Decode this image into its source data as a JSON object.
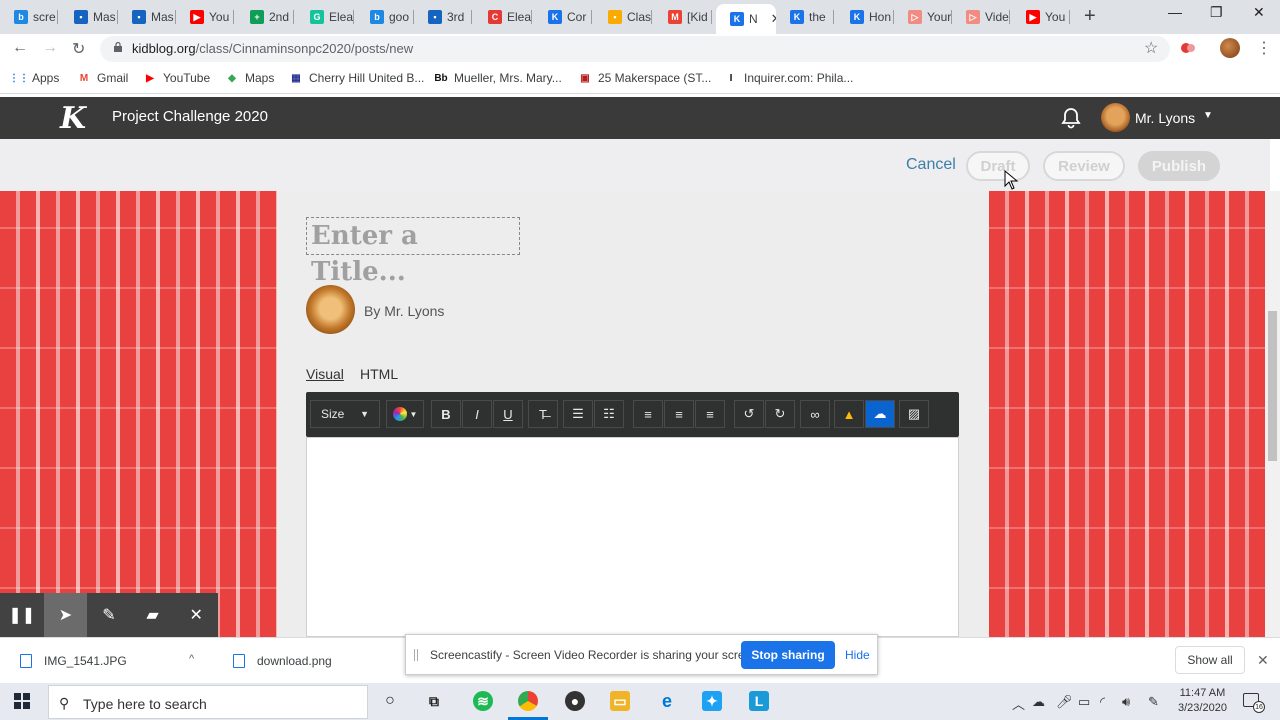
{
  "colors": {
    "tabstrip_bg": "#dee1e6",
    "kb_header_bg": "#3a3a3a",
    "actionbar_bg": "#eeeef0",
    "pattern_red": "#e8413f",
    "pattern_pink": "#f29a9a",
    "link_blue": "#3b7fa6",
    "editor_toolbar_bg": "#2f3030",
    "stop_button_blue": "#1a73e8"
  },
  "browser": {
    "tabs": [
      {
        "title": "scre",
        "icon": "kidblog-b-icon",
        "color": "#1e88e5",
        "glyph": "b"
      },
      {
        "title": "Mas",
        "icon": "person-card-icon",
        "color": "#1565c0",
        "glyph": "▪"
      },
      {
        "title": "Mas",
        "icon": "person-card-icon",
        "color": "#1565c0",
        "glyph": "▪"
      },
      {
        "title": "You",
        "icon": "youtube-icon",
        "color": "#ff0000",
        "glyph": "▶"
      },
      {
        "title": "2nd",
        "icon": "sheets-plus-icon",
        "color": "#0f9d58",
        "glyph": "+"
      },
      {
        "title": "Elea",
        "icon": "grammarly-g-icon",
        "color": "#15c39a",
        "glyph": "G"
      },
      {
        "title": "goo",
        "icon": "kidblog-b-icon",
        "color": "#1e88e5",
        "glyph": "b"
      },
      {
        "title": "3rd",
        "icon": "person-card-icon",
        "color": "#1565c0",
        "glyph": "▪"
      },
      {
        "title": "Elea",
        "icon": "clip-icon",
        "color": "#e53935",
        "glyph": "C"
      },
      {
        "title": "Cor",
        "icon": "kidblog-k-icon",
        "color": "#1a73e8",
        "glyph": "K"
      },
      {
        "title": "Clas",
        "icon": "classroom-icon",
        "color": "#f9ab00",
        "glyph": "▪"
      },
      {
        "title": "[Kid",
        "icon": "gmail-icon",
        "color": "#ea4335",
        "glyph": "M"
      },
      {
        "title": "N",
        "icon": "kidblog-k-icon",
        "color": "#1a73e8",
        "glyph": "K",
        "active": true
      },
      {
        "title": "the",
        "icon": "kidblog-k-icon",
        "color": "#1a73e8",
        "glyph": "K"
      },
      {
        "title": "Hon",
        "icon": "kidblog-k-icon",
        "color": "#1a73e8",
        "glyph": "K"
      },
      {
        "title": "Your",
        "icon": "screencastify-icon",
        "color": "#f28b82",
        "glyph": "▷"
      },
      {
        "title": "Vide",
        "icon": "screencastify-icon",
        "color": "#f28b82",
        "glyph": "▷"
      },
      {
        "title": "You",
        "icon": "youtube-icon",
        "color": "#ff0000",
        "glyph": "▶"
      }
    ],
    "new_tab_glyph": "+",
    "close_glyph": "✕",
    "window_buttons": {
      "minimize": "—",
      "restore": "❐",
      "close": "✕"
    },
    "url_domain": "kidblog.org",
    "url_path": "/class/Cinnaminsonpc2020/posts/new",
    "bookmarks": [
      {
        "label": "Apps",
        "icon": "apps-grid-icon",
        "glyph": "⋮⋮",
        "color": "#1a73e8"
      },
      {
        "label": "Gmail",
        "icon": "gmail-icon",
        "glyph": "M",
        "color": "#ea4335"
      },
      {
        "label": "YouTube",
        "icon": "youtube-icon",
        "glyph": "▶",
        "color": "#ff0000"
      },
      {
        "label": "Maps",
        "icon": "maps-icon",
        "glyph": "◆",
        "color": "#34a853"
      },
      {
        "label": "Cherry Hill United B...",
        "icon": "bookmark-site-icon",
        "glyph": "▦",
        "color": "#283593"
      },
      {
        "label": "Mueller, Mrs. Mary...",
        "icon": "blackboard-icon",
        "glyph": "Bb",
        "color": "#111111"
      },
      {
        "label": "25 Makerspace (ST...",
        "icon": "bookmark-site-icon",
        "glyph": "▣",
        "color": "#b71c1c"
      },
      {
        "label": "Inquirer.com: Phila...",
        "icon": "inquirer-icon",
        "glyph": "I",
        "color": "#111111"
      }
    ]
  },
  "kidblog": {
    "logo": "K",
    "class_title": "Project Challenge 2020",
    "user_name": "Mr. Lyons",
    "caret": "▼",
    "actions": {
      "cancel": "Cancel",
      "draft": "Draft",
      "review": "Review",
      "publish": "Publish"
    },
    "post": {
      "title_placeholder": "Enter a Title...",
      "byline": "By Mr. Lyons",
      "mode_visual": "Visual",
      "mode_html": "HTML"
    },
    "editor_toolbar": {
      "size_label": "Size",
      "buttons": [
        {
          "name": "bold-button",
          "glyph": "B"
        },
        {
          "name": "italic-button",
          "glyph": "I"
        },
        {
          "name": "underline-button",
          "glyph": "U"
        },
        {
          "name": "clear-format-button",
          "glyph": "T̶"
        },
        {
          "name": "bullet-list-button",
          "glyph": "☰"
        },
        {
          "name": "numbered-list-button",
          "glyph": "☷"
        },
        {
          "name": "align-left-button",
          "glyph": "≡"
        },
        {
          "name": "align-center-button",
          "glyph": "≡"
        },
        {
          "name": "align-right-button",
          "glyph": "≡"
        },
        {
          "name": "undo-button",
          "glyph": "↺"
        },
        {
          "name": "redo-button",
          "glyph": "↻"
        },
        {
          "name": "link-button",
          "glyph": "∞"
        },
        {
          "name": "google-drive-button",
          "glyph": "▲"
        },
        {
          "name": "onedrive-button",
          "glyph": "☁"
        },
        {
          "name": "image-button",
          "glyph": "▨"
        }
      ]
    }
  },
  "screencastify": {
    "tools": [
      {
        "name": "pause-icon",
        "glyph": "❚❚"
      },
      {
        "name": "cursor-tool-icon",
        "glyph": "➤",
        "selected": true
      },
      {
        "name": "pen-tool-icon",
        "glyph": "✎"
      },
      {
        "name": "highlighter-tool-icon",
        "glyph": "▰"
      },
      {
        "name": "close-tools-icon",
        "glyph": "✕"
      }
    ],
    "banner_text": "Screencastify - Screen Video Recorder is sharing your screen.",
    "stop_sharing": "Stop sharing",
    "hide": "Hide"
  },
  "downloads": {
    "items": [
      {
        "name": "IMG_1541.JPG"
      },
      {
        "name": "download.png"
      }
    ],
    "show_all": "Show all",
    "caret": "^"
  },
  "taskbar": {
    "search_placeholder": "Type here to search",
    "time": "11:47 AM",
    "date": "3/23/2020",
    "notification_count": "16"
  }
}
